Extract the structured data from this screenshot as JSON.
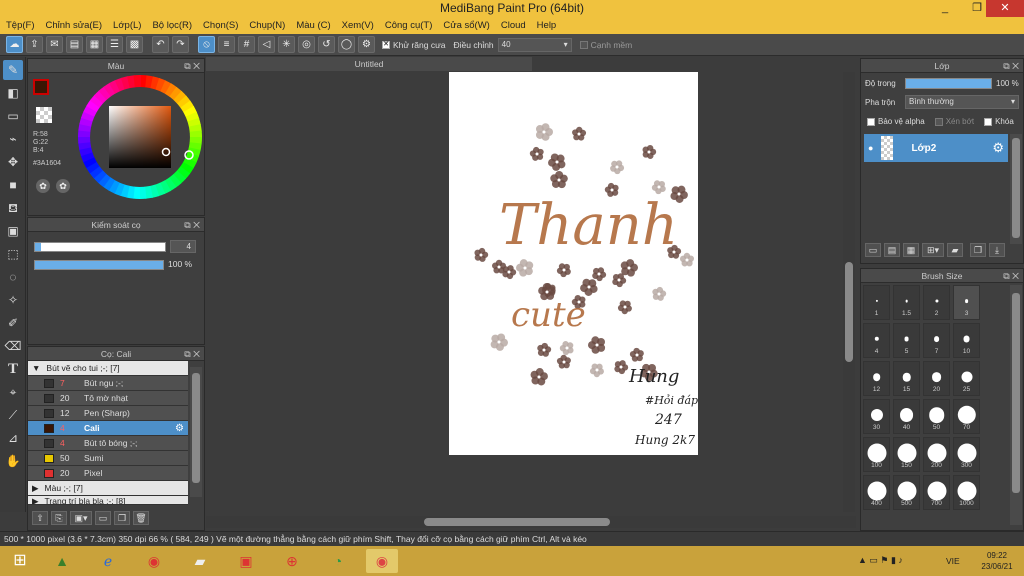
{
  "window": {
    "title": "MediBang Paint Pro (64bit)",
    "minimize": "_",
    "maximize": "❐",
    "close": "✕"
  },
  "menu": [
    "Tệp(F)",
    "Chỉnh sửa(E)",
    "Lớp(L)",
    "Bộ lọc(R)",
    "Chọn(S)",
    "Chụp(N)",
    "Màu (C)",
    "Xem(V)",
    "Công cụ(T)",
    "Cửa sổ(W)",
    "Cloud",
    "Help"
  ],
  "toolbar": {
    "antialias_label": "Khử răng cưa",
    "correction_label": "Điều chỉnh",
    "correction_value": "40",
    "edge_label": "Cạnh mềm"
  },
  "color_panel": {
    "title": "Màu",
    "r": "R:58",
    "g": "G:22",
    "b": "B:4",
    "hex": "#3A1604",
    "fg": "#3A1604",
    "bg": "#ffffff"
  },
  "brush_control": {
    "title": "Kiểm soát cọ",
    "size_value": "4",
    "opacity_value": "100 %",
    "opacity_fraction": 1.0
  },
  "brush_panel": {
    "title": "Cọ: Cali",
    "group": "Bút vẽ cho tui ;-; [7]",
    "brushes": [
      {
        "size": "7",
        "name": "Bút ngu ;-;",
        "color": "#333333",
        "red": true
      },
      {
        "size": "20",
        "name": "Tô mờ nhạt",
        "color": "#333333",
        "red": false
      },
      {
        "size": "12",
        "name": "Pen (Sharp)",
        "color": "#333333",
        "red": false
      },
      {
        "size": "4",
        "name": "Cali",
        "color": "#3A1604",
        "red": true
      },
      {
        "size": "4",
        "name": "Bút tô bóng ;-;",
        "color": "#333333",
        "red": true
      },
      {
        "size": "50",
        "name": "Sumi",
        "color": "#e8c800",
        "red": false
      },
      {
        "size": "20",
        "name": "Pixel",
        "color": "#e03030",
        "red": false
      }
    ],
    "group2": "Màu ;-; [7]",
    "group3": "Trang trí bla bla ;-; [8]"
  },
  "document": {
    "tab": "Untitled",
    "title_text": "Thanh",
    "subtitle_text": "cute",
    "signature_lines": [
      "Hung",
      "#Hỏi đáp",
      "247",
      "Hung 2k7"
    ]
  },
  "layer_panel": {
    "title": "Lớp",
    "opacity_label": "Độ trong",
    "opacity_value": "100 %",
    "opacity_fraction": 1.0,
    "blend_label": "Pha trộn",
    "blend_value": "Bình thường",
    "protect_alpha": "Bảo vệ alpha",
    "clip": "Xén bớt",
    "lock": "Khóa",
    "layer_name": "Lớp2"
  },
  "brush_size_panel": {
    "title": "Brush Size",
    "sizes": [
      "1",
      "1.5",
      "2",
      "3",
      "4",
      "5",
      "7",
      "10",
      "12",
      "15",
      "20",
      "25",
      "30",
      "40",
      "50",
      "70",
      "100",
      "150",
      "200",
      "300",
      "400",
      "500",
      "700",
      "1000"
    ]
  },
  "status": {
    "text": "500 * 1000 pixel   (3.6 * 7.3cm)   350 dpi   66 %   ( 584, 249 )   Vẽ một đường thẳng bằng cách giữ phím Shift, Thay đổi cỡ cọ bằng cách giữ phím Ctrl, Alt và kéo"
  },
  "taskbar": {
    "lang": "VIE",
    "time": "09:22",
    "date": "23/06/21"
  }
}
